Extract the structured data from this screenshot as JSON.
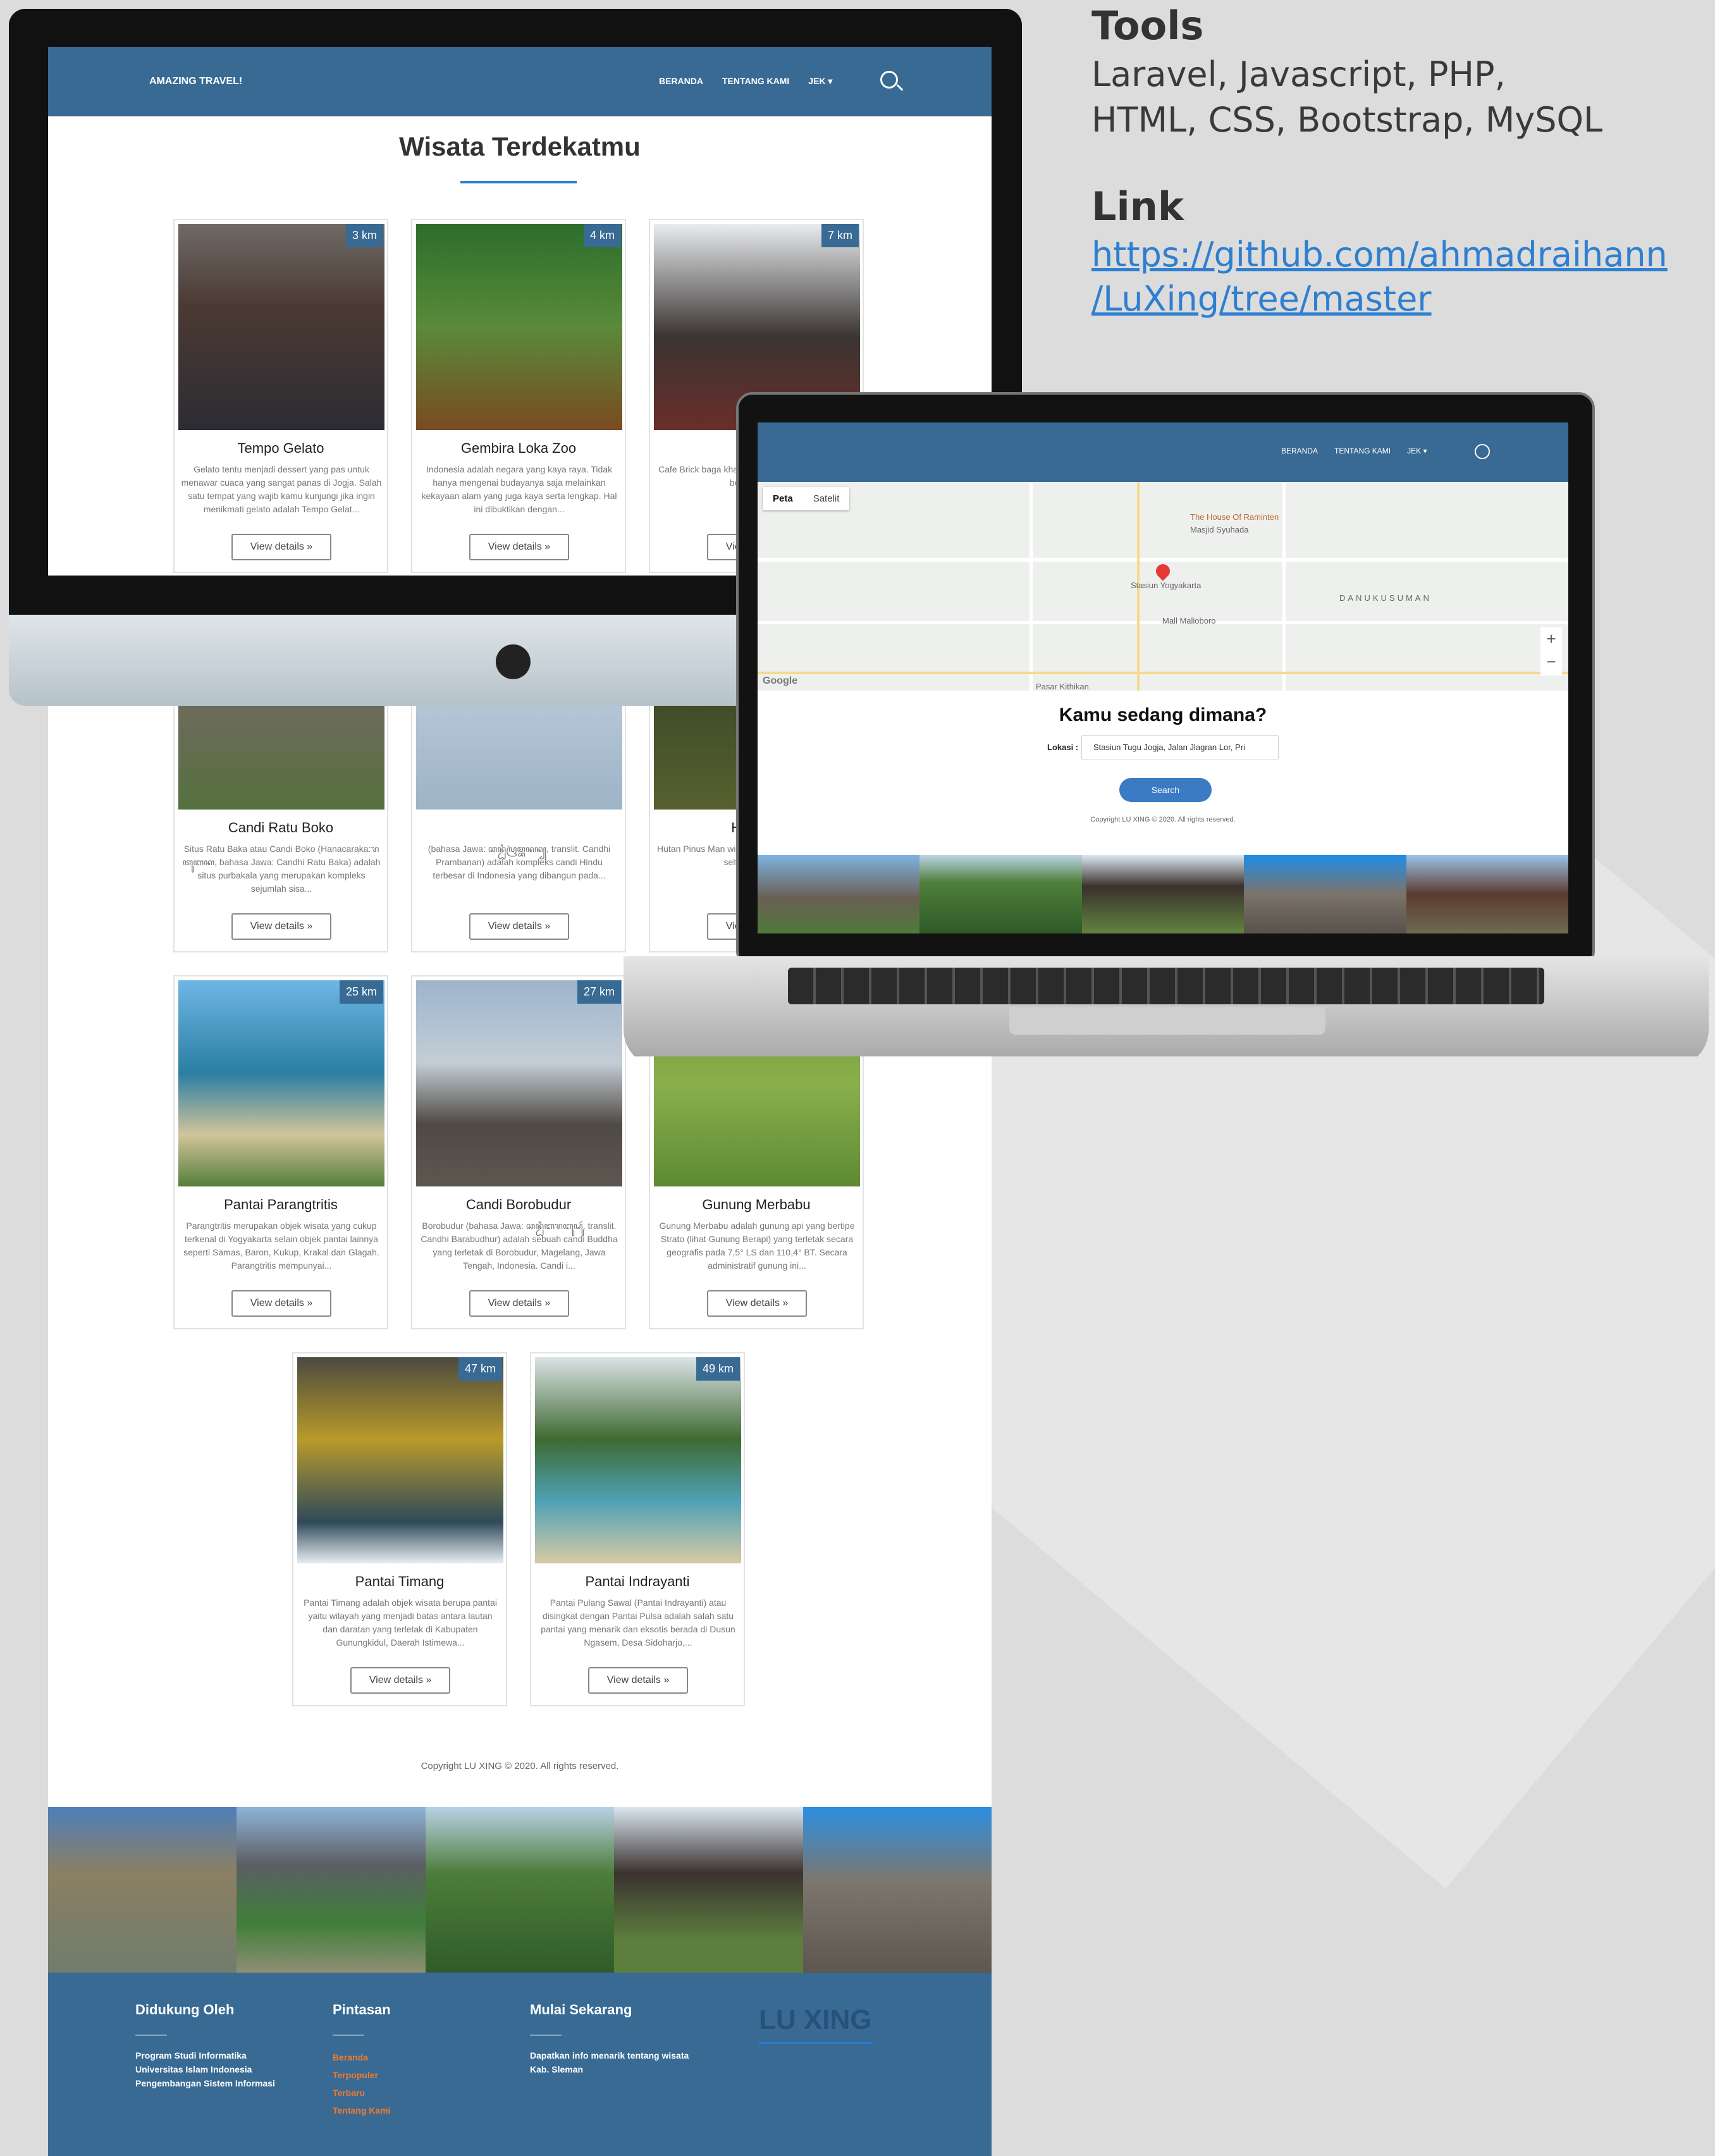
{
  "side": {
    "tools_heading": "Tools",
    "tools_line1": "Laravel, Javascript, PHP,",
    "tools_line2": "HTML, CSS, Bootstrap, MySQL",
    "link_heading": "Link",
    "link_line1": "https://github.com/ahmadraihann",
    "link_line2": "/LuXing/tree/master"
  },
  "site": {
    "brand": "AMAZING TRAVEL!",
    "nav": [
      "BERANDA",
      "TENTANG KAMI",
      "JEK ▾"
    ],
    "title": "Wisata Terdekatmu",
    "view_label": "View details »",
    "cards": [
      {
        "name": "Tempo Gelato",
        "km": "3 km",
        "desc": "Gelato tentu menjadi dessert yang pas untuk menawar cuaca yang sangat panas di Jogja. Salah satu tempat yang wajib kamu kunjungi jika ingin menikmati gelato adalah Tempo Gelat..."
      },
      {
        "name": "Gembira Loka Zoo",
        "km": "4 km",
        "desc": "Indonesia adalah negara yang kaya raya. Tidak hanya mengenai budayanya saja melainkan kekayaan alam yang juga kaya serta lengkap. Hal ini dibuktikan dengan..."
      },
      {
        "name": "Brick",
        "km": "7 km",
        "desc": "Cafe Brick baga khazanah kuliner komitmennya m berkualitas, di"
      },
      {
        "name": "Candi Ratu Boko",
        "km": "",
        "desc": "Situs Ratu Baka atau Candi Boko (Hanacaraka:ꦫꦠꦸꦧꦏ, bahasa Jawa: Candhi Ratu Baka) adalah situs purbakala yang merupakan kompleks sejumlah sisa..."
      },
      {
        "name": "",
        "km": "",
        "desc": "(bahasa Jawa: ꦕꦤ꧀ꦝꦶꦥꦿꦩ꧀ꦧꦤꦤ꧀, translit. Candhi Prambanan) adalah kompleks candi Hindu terbesar di Indonesia yang dibangun pada..."
      },
      {
        "name": "Hutan P",
        "km": "",
        "desc": "Hutan Pinus Man wisata alam yan yang dijadikan s selfie yang dibun"
      },
      {
        "name": "Pantai Parangtritis",
        "km": "25 km",
        "desc": "Parangtritis merupakan objek wisata yang cukup terkenal di Yogyakarta selain objek pantai lainnya seperti Samas, Baron, Kukup, Krakal dan Glagah. Parangtritis mempunyai..."
      },
      {
        "name": "Candi Borobudur",
        "km": "27 km",
        "desc": "Borobudur (bahasa Jawa: ꦕꦤ꧀ꦝꦶꦧꦫꦧꦸꦝꦸꦂ, translit. Candhi Barabudhur) adalah sebuah candi Buddha yang terletak di Borobudur, Magelang, Jawa Tengah, Indonesia. Candi i..."
      },
      {
        "name": "Gunung Merbabu",
        "km": "",
        "desc": "Gunung Merbabu adalah gunung api yang bertipe Strato (lihat Gunung Berapi) yang terletak secara geografis pada 7,5° LS dan 110,4° BT. Secara administratif gunung ini..."
      },
      {
        "name": "Pantai Timang",
        "km": "47 km",
        "desc": "Pantai Timang adalah objek wisata berupa pantai yaitu wilayah yang menjadi batas antara lautan dan daratan yang terletak di Kabupaten Gunungkidul, Daerah Istimewa..."
      },
      {
        "name": "Pantai Indrayanti",
        "km": "49 km",
        "desc": "Pantai Pulang Sawal (Pantai Indrayanti) atau disingkat dengan Pantai Pulsa adalah salah satu pantai yang menarik dan eksotis berada di Dusun Ngasem, Desa Sidoharjo,..."
      }
    ],
    "copyright": "Copyright LU XING © 2020. All rights reserved.",
    "footer": {
      "col1_title": "Didukung Oleh",
      "col1_lines": [
        "Program Studi Informatika",
        "Universitas Islam Indonesia",
        "Pengembangan Sistem Informasi"
      ],
      "col2_title": "Pintasan",
      "col2_links": [
        "Beranda",
        "Terpopuler",
        "Terbaru",
        "Tentang Kami"
      ],
      "col3_title": "Mulai Sekarang",
      "col3_lines": [
        "Dapatkan info menarik tentang wisata",
        "Kab. Sleman"
      ],
      "logo": "LU XING"
    }
  },
  "laptop": {
    "nav": [
      "BERANDA",
      "TENTANG KAMI",
      "JEK ▾"
    ],
    "map_tabs": [
      "Peta",
      "Satelit"
    ],
    "map_labels": [
      "Stasiun Yogyakarta",
      "DANUKUSUMAN",
      "Mall Malioboro",
      "Pasar Kithikan",
      "The House Of Raminten",
      "Masjid Syuhada",
      "Google"
    ],
    "heading": "Kamu sedang dimana?",
    "location_label": "Lokasi :",
    "location_value": "Stasiun Tugu Jogja, Jalan Jlagran Lor, Pri",
    "search_label": "Search",
    "copyright": "Copyright LU XING © 2020. All rights reserved."
  }
}
